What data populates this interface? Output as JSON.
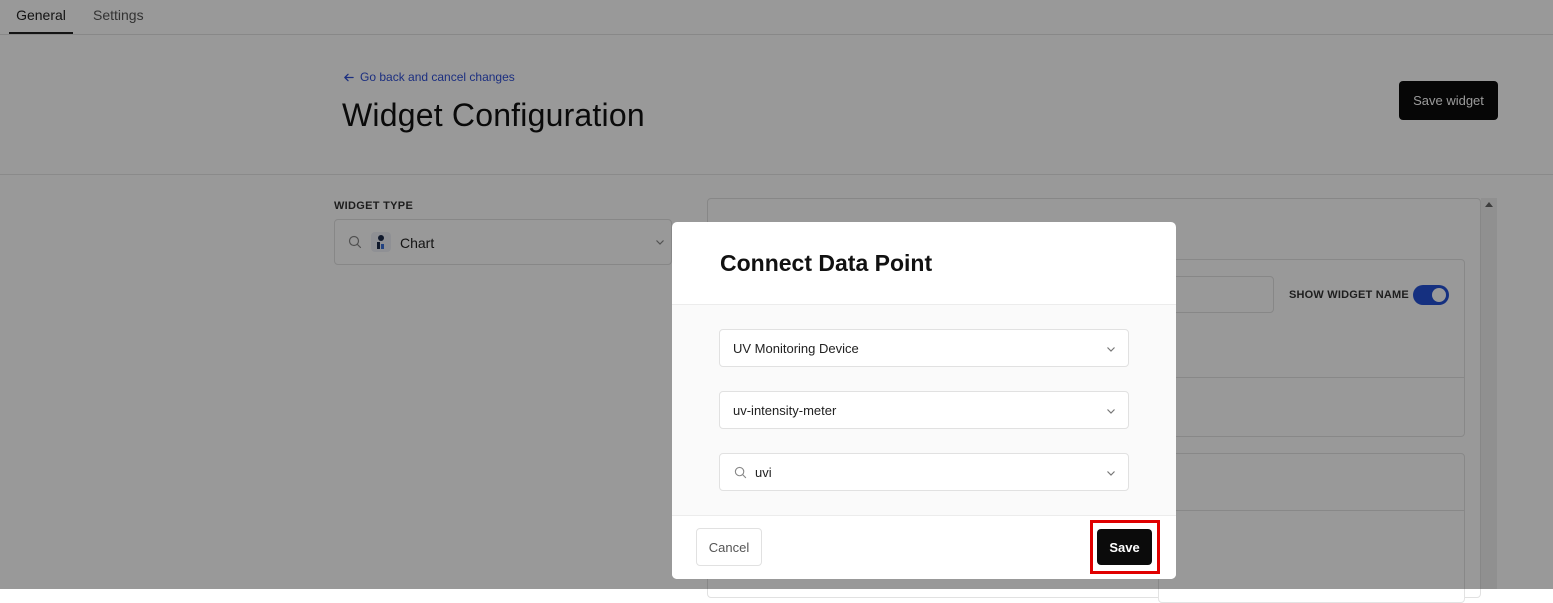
{
  "tabs": [
    {
      "label": "General",
      "active": true
    },
    {
      "label": "Settings",
      "active": false
    }
  ],
  "header": {
    "back_link": "Go back and cancel changes",
    "title": "Widget Configuration",
    "save_widget_label": "Save widget"
  },
  "widget_type": {
    "label": "WIDGET TYPE",
    "selected": "Chart"
  },
  "panel": {
    "show_widget_name_label": "SHOW WIDGET NAME",
    "show_widget_name_on": true
  },
  "modal": {
    "title": "Connect Data Point",
    "device_select": "UV Monitoring Device",
    "sensor_select": "uv-intensity-meter",
    "datapoint_select": "uvi",
    "cancel_label": "Cancel",
    "save_label": "Save"
  },
  "colors": {
    "primary_button": "#0b0b0b",
    "link": "#2f4fd6",
    "toggle_on": "#2451d6",
    "highlight": "#e00000"
  }
}
